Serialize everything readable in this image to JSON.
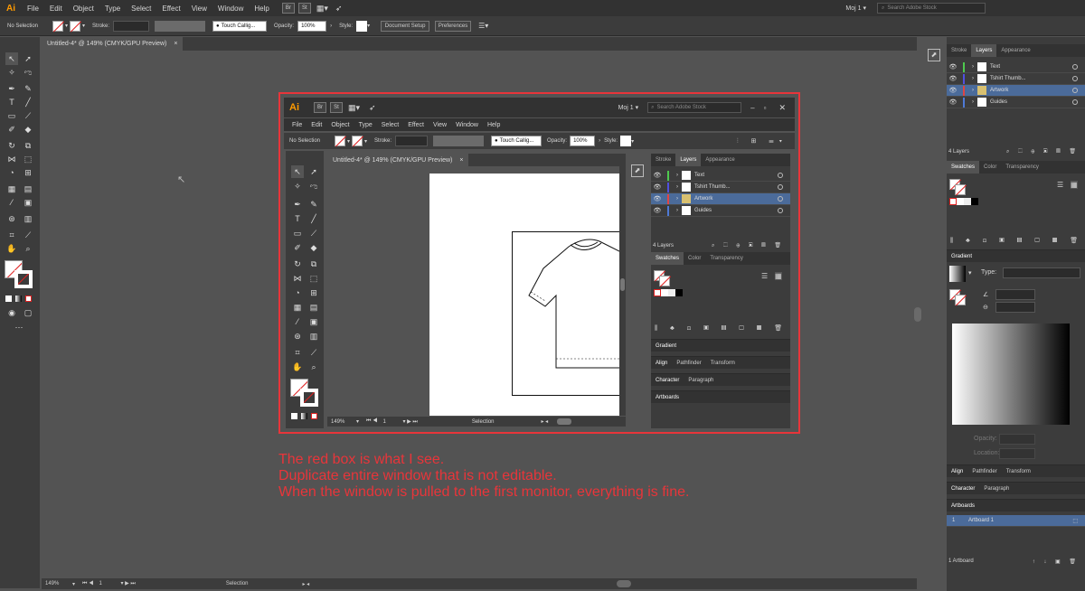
{
  "app": {
    "logo": "Ai",
    "workspace": "Moj 1",
    "search_placeholder": "Search Adobe Stock",
    "bridge": "Br",
    "stock": "St"
  },
  "menu": [
    "File",
    "Edit",
    "Object",
    "Type",
    "Select",
    "Effect",
    "View",
    "Window",
    "Help"
  ],
  "control": {
    "selection": "No Selection",
    "stroke_label": "Stroke:",
    "brush": "Touch Callig...",
    "opacity_label": "Opacity:",
    "opacity_value": "100%",
    "style_label": "Style:",
    "doc_setup": "Document Setup",
    "preferences": "Preferences"
  },
  "document": {
    "tab": "Untitled-4* @ 149% (CMYK/GPU Preview)",
    "close": "×",
    "zoom": "149%",
    "page": "1",
    "status": "Selection"
  },
  "layers_panel": {
    "tabs": [
      "Stroke",
      "Layers",
      "Appearance"
    ],
    "active": "Layers",
    "count": "4 Layers",
    "layers": [
      {
        "name": "Text",
        "color": "#4ec94e"
      },
      {
        "name": "Tshirt Thumb...",
        "color": "#5050e0"
      },
      {
        "name": "Artwork",
        "color": "#e04444"
      },
      {
        "name": "Guides",
        "color": "#4e7ad6"
      }
    ]
  },
  "swatches_panel": {
    "tabs": [
      "Swatches",
      "Color",
      "Transparency"
    ],
    "active": "Swatches"
  },
  "gradient_panel": {
    "title": "Gradient",
    "type_label": "Type:",
    "opacity_label": "Opacity:",
    "location_label": "Location:"
  },
  "collapsed": [
    {
      "tabs": [
        "Align",
        "Pathfinder",
        "Transform"
      ]
    },
    {
      "tabs": [
        "Character",
        "Paragraph"
      ]
    },
    {
      "tabs": [
        "Artboards"
      ]
    }
  ],
  "artboards": {
    "row_num": "1",
    "row_name": "Artboard 1",
    "count": "1 Artboard"
  },
  "inner_window": {
    "menu": [
      "File",
      "Edit",
      "Object",
      "Type",
      "Select",
      "Effect",
      "View",
      "Window",
      "Help"
    ],
    "sections": [
      "Gradient"
    ]
  },
  "notes": [
    "The red box is what I see.",
    "Duplicate entire window that is not editable.",
    "When the window is pulled to the first monitor, everything is fine."
  ],
  "colors": {
    "highlight": "#e8353a",
    "accent": "#ff9a00",
    "selected_row": "#4b6b9a"
  }
}
